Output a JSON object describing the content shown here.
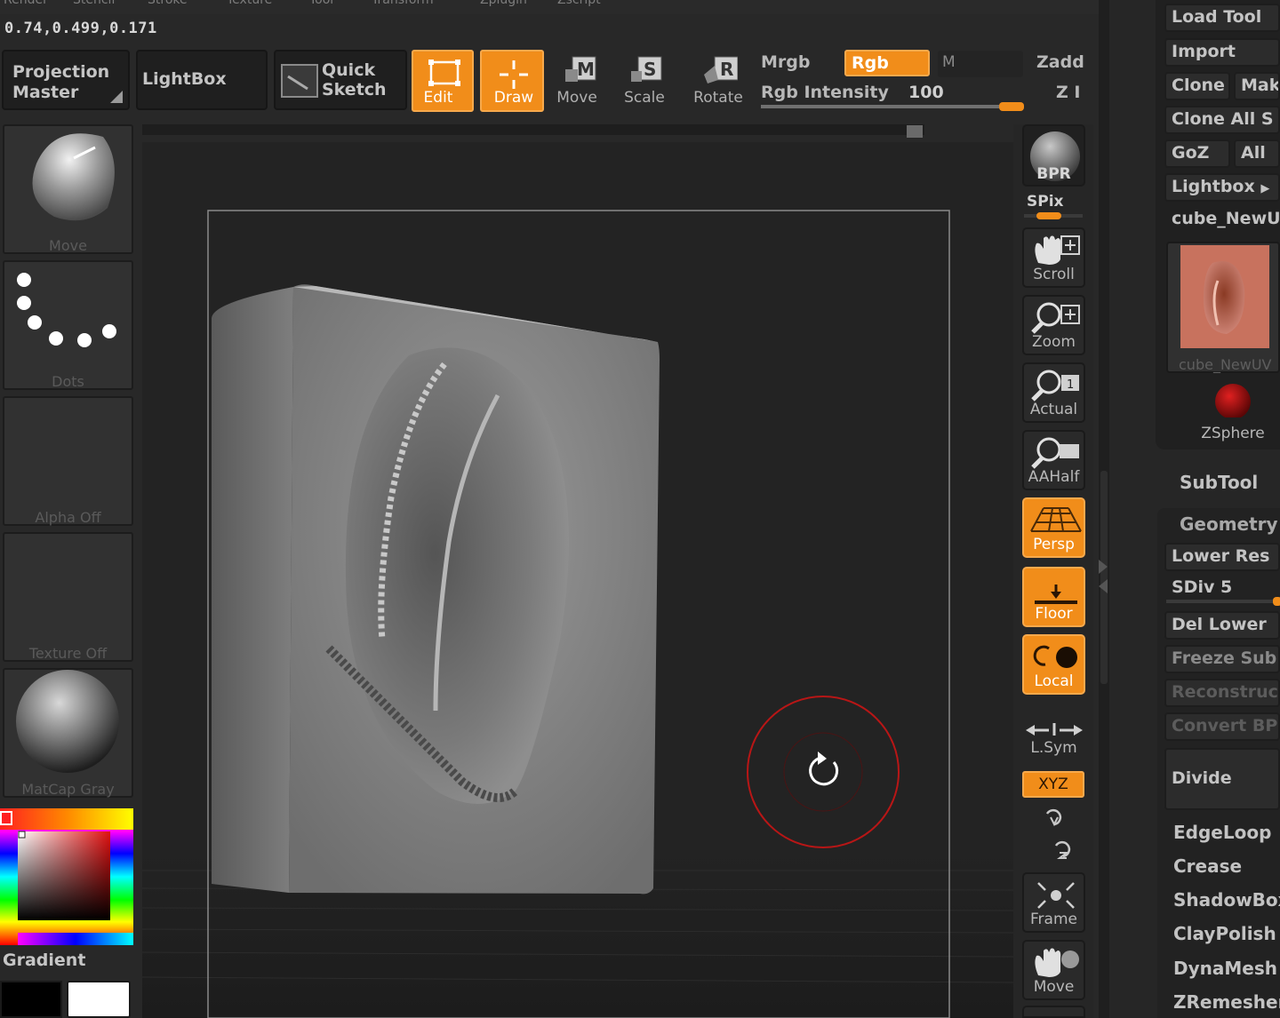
{
  "menu": [
    "Render",
    "Stencil",
    "Stroke",
    "Texture",
    "Tool",
    "Transform",
    "Zplugin",
    "Zscript"
  ],
  "coords": "0.74,0.499,0.171",
  "top": {
    "projection_master": "Projection Master",
    "lightbox": "LightBox",
    "quick_sketch": "Quick Sketch",
    "edit": "Edit",
    "draw": "Draw",
    "move": "Move",
    "scale": "Scale",
    "rotate": "Rotate",
    "mrgb": "Mrgb",
    "rgb": "Rgb",
    "m": "M",
    "zadd": "Zadd",
    "rgb_intensity_label": "Rgb Intensity",
    "rgb_intensity_value": "100",
    "rgb_intensity_fraction": 1.0,
    "z_label": "Z I"
  },
  "left": {
    "brush": "Move",
    "stroke": "Dots",
    "alpha": "Alpha Off",
    "texture": "Texture Off",
    "material": "MatCap Gray",
    "gradient": "Gradient"
  },
  "right_toolbar": {
    "bpr": "BPR",
    "spix": "SPix",
    "scroll": "Scroll",
    "zoom": "Zoom",
    "actual": "Actual",
    "aahalf": "AAHalf",
    "persp": "Persp",
    "floor": "Floor",
    "local": "Local",
    "lsym": "L.Sym",
    "xyz": "XYZ",
    "frame": "Frame",
    "move": "Move"
  },
  "tool_panel": {
    "load_tool": "Load Tool",
    "import": "Import",
    "clone": "Clone",
    "make": "Mak",
    "clone_all": "Clone All S",
    "goz": "GoZ",
    "all": "All",
    "lightbox": "Lightbox",
    "tool_name": "cube_NewU",
    "thumb_caption": "cube_NewUV",
    "zsphere": "ZSphere",
    "subtool": "SubTool",
    "geometry": "Geometry",
    "lower_res": "Lower Res",
    "sdiv": "SDiv 5",
    "del_lower": "Del Lower",
    "freeze_sub": "Freeze Sub",
    "reconstruct": "Reconstruc",
    "convert": "Convert BP",
    "divide": "Divide",
    "edgeloop": "EdgeLoop",
    "crease": "Crease",
    "shadowbox": "ShadowBox",
    "claypolish": "ClayPolish",
    "dynamesh": "DynaMesh",
    "zremesher": "ZRemesher"
  },
  "colors": {
    "accent": "#f18d1a",
    "cursor_ring": "#b81616"
  }
}
